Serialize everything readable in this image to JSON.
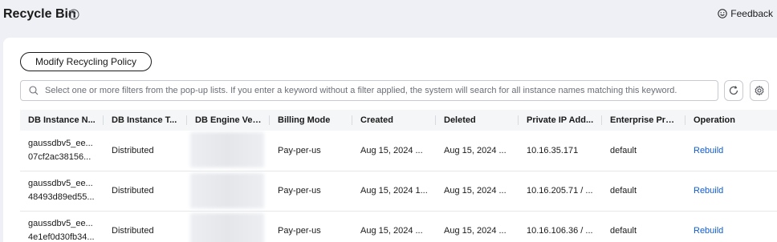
{
  "header": {
    "title": "Recycle Bin",
    "feedback_label": "Feedback"
  },
  "toolbar": {
    "policy_button_label": "Modify Recycling Policy"
  },
  "search": {
    "placeholder": "Select one or more filters from the pop-up lists. If you enter a keyword without a filter applied, the system will search for all instance names matching this keyword."
  },
  "table": {
    "columns": [
      "DB Instance N...",
      "DB Instance T...",
      "DB Engine Ver...",
      "Billing Mode",
      "Created",
      "Deleted",
      "Private IP Add...",
      "Enterprise Pro...",
      "Operation"
    ],
    "rows": [
      {
        "name_line1": "gaussdbv5_ee...",
        "name_line2": "07cf2ac38156...",
        "type": "Distributed",
        "engine": "",
        "billing": "Pay-per-us",
        "created": "Aug 15, 2024 ...",
        "deleted": "Aug 15, 2024 ...",
        "ip": "10.16.35.171",
        "project": "default",
        "operation": "Rebuild"
      },
      {
        "name_line1": "gaussdbv5_ee...",
        "name_line2": "48493d89ed55...",
        "type": "Distributed",
        "engine": "",
        "billing": "Pay-per-us",
        "created": "Aug 15, 2024 1...",
        "deleted": "Aug 15, 2024 ...",
        "ip": "10.16.205.71 / ...",
        "project": "default",
        "operation": "Rebuild"
      },
      {
        "name_line1": "gaussdbv5_ee...",
        "name_line2": "4e1ef0d30fb34...",
        "type": "Distributed",
        "engine": "",
        "billing": "Pay-per-us",
        "created": "Aug 15, 2024 ...",
        "deleted": "Aug 15, 2024 ...",
        "ip": "10.16.106.36 / ...",
        "project": "default",
        "operation": "Rebuild"
      }
    ]
  },
  "icons": {
    "help": "question-circle-icon",
    "feedback": "smile-face-icon",
    "search": "search-icon",
    "refresh": "refresh-icon",
    "settings": "gear-icon"
  }
}
